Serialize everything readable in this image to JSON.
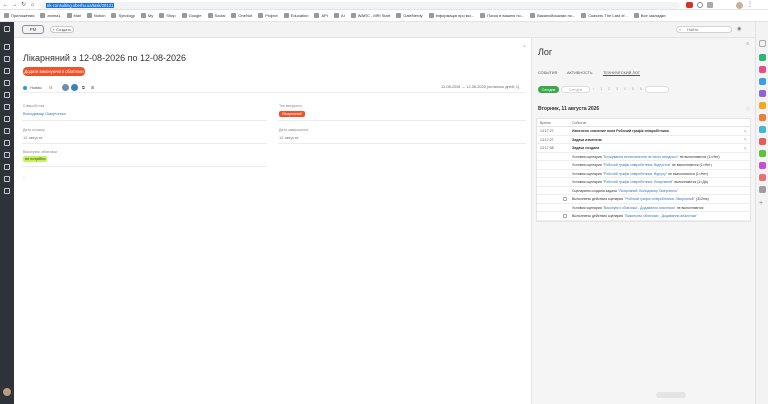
{
  "browser": {
    "url_prefix": "",
    "url_selected": "ek-consulting.oberhu.ua/task/20121",
    "bookmarks": [
      "Приложения",
      "anima1",
      "Mail",
      "Notion",
      "Synology",
      "My",
      "Shop",
      "Google",
      "Social",
      "OneNot",
      "Project",
      "Education",
      "API",
      "AI",
      "WARC - MRI Start",
      "GateNerdy",
      "Інформація про ми...",
      "Поиск в вашею по...",
      "Вакансійськими по...",
      "Скачать The Last of...",
      "Все закладки"
    ]
  },
  "app": {
    "logo": "PM",
    "create_label": "+ Создать",
    "search_placeholder": "Найти"
  },
  "task": {
    "title": "Лікарняний з 12-08-2026 по 12-08-2026",
    "add_button": "Додати виконуючого обов'язки",
    "toolbar": {
      "status": "Новая",
      "period": "12-08-2026 → 12-08-2026 (осталось дней: 1)"
    },
    "fields": {
      "employee_label": "Співробітник",
      "employee_value": "Володимир Омерченко",
      "type_label": "Тип вихідного",
      "type_value": "Лікарняний",
      "start_label": "Дата початку",
      "start_value": "12 августа",
      "end_label": "Дата завершення",
      "end_value": "12 августа",
      "acting_label": "Виконуючі обов'язки",
      "acting_value": "не потрібно"
    }
  },
  "log": {
    "title": "Лог",
    "tabs": [
      "СОБЫТИЯ",
      "АКТИВНОСТЬ",
      "ТЕХНИЧЕСКИЙ ЛОГ"
    ],
    "filter_today": "Сегодня",
    "filter_date": "Сегодня",
    "day": "Вторник, 11 августа 2026",
    "col_time": "Время",
    "col_event": "Событие",
    "rows": [
      {
        "time": "13:17:27",
        "text": "Изменено значение поля Робочий графік співробітника",
        "bold": true
      },
      {
        "time": "13:17:27",
        "text": "Задача изменена",
        "bold": true
      },
      {
        "time": "13:17:08",
        "text": "Задача создана",
        "bold": true
      },
      {
        "time": "",
        "pre": "Условия сценария ",
        "quote": "\"Блокування встановлення не свого вихідного\"",
        "post": " не выполняются (1=Нет)"
      },
      {
        "time": "",
        "pre": "Условия сценария ",
        "quote": "\"Робочий графік співробітника: Відпустка\"",
        "post": " не выполняются (1=Нет)"
      },
      {
        "time": "",
        "pre": "Условия сценария ",
        "quote": "\"Робочий графік співробітника: Відгулу\"",
        "post": " не выполняются (1=Нет)"
      },
      {
        "time": "",
        "pre": "Условия сценария ",
        "quote": "\"Робочий графік співробітника: Лікарняний\"",
        "post": " выполняются (1=Да)"
      },
      {
        "time": "",
        "pre": "Сценарием создана задача ",
        "quote": "\"Лікарняний: Володимир Омерченко\"",
        "post": ""
      },
      {
        "time": "",
        "check": true,
        "pre": "Выполнены действия сценария ",
        "quote": "\"Робочий графік співробітника: Лікарняний\"",
        "post": " (312ms)"
      },
      {
        "time": "",
        "pre": "Условия сценария ",
        "quote": "\"Виконуючі обов'язки - Додавання аналітики\"",
        "post": " не выполняются"
      },
      {
        "time": "",
        "check": true,
        "pre": "Выполнены действия сценария ",
        "quote": "\"Виконуючі обов'язки - Додавання аналітики\"",
        "post": ""
      }
    ]
  }
}
